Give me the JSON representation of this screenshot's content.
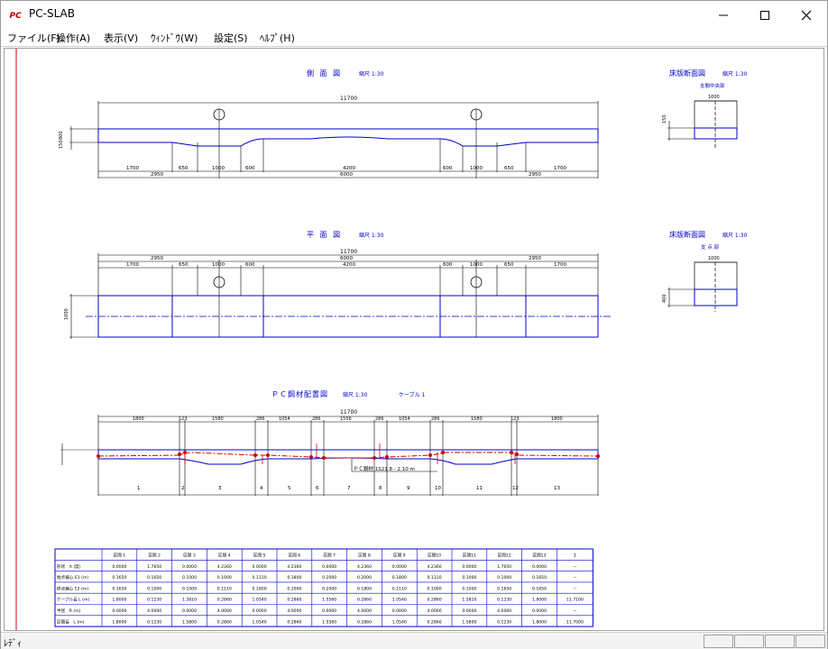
{
  "window": {
    "title": "PC-SLAB"
  },
  "menu": {
    "items": [
      "ファイル(F)",
      "操作(A)",
      "表示(V)",
      "ｳｨﾝﾄﾞｳ(W)",
      "設定(S)",
      "ﾍﾙﾌﾟ(H)"
    ]
  },
  "status": {
    "text": "ﾚﾃﾞｨ"
  },
  "side_view": {
    "title": "側 面 図",
    "scale": "縮尺 1:30",
    "total": "11700",
    "dims_bottom": [
      "1700",
      "650",
      "1000",
      "600",
      "4200",
      "600",
      "1000",
      "650",
      "1700"
    ],
    "dims_bottom2": [
      "2950",
      "6000",
      "2950"
    ],
    "left_dims": [
      "800",
      "150"
    ]
  },
  "plan_view": {
    "title": "平 面 図",
    "scale": "縮尺 1:30",
    "total": "11700",
    "dims_top1": [
      "2950",
      "6000",
      "2950"
    ],
    "dims_top2": [
      "1700",
      "650",
      "1000",
      "600",
      "4200",
      "600",
      "1000",
      "650",
      "1700"
    ],
    "width": "1000"
  },
  "section1": {
    "title": "床版断面図",
    "scale": "縮尺 1:30",
    "subtitle": "支間中央部",
    "width": "1000",
    "thickness": "150"
  },
  "section2": {
    "title": "床版断面図",
    "scale": "縮尺 1:30",
    "subtitle": "支 点 部",
    "width": "1000",
    "thickness": "400"
  },
  "pc_view": {
    "title": "ＰＣ鋼材配置図",
    "scale": "縮尺 1:30",
    "cable": "ケーブル 1",
    "total": "11700",
    "dims_top": [
      "1800",
      "123",
      "1580",
      "286",
      "1054",
      "286",
      "1556",
      "286",
      "1054",
      "286",
      "1580",
      "123",
      "1800"
    ],
    "segments": [
      "1",
      "2",
      "3",
      "4",
      "5",
      "6",
      "7",
      "8",
      "9",
      "10",
      "11",
      "12",
      "13"
    ],
    "annotation": "ＰＣ鋼材 1S21.8 ‐ 2.10 m"
  },
  "table": {
    "headers": [
      "",
      "区間 1",
      "区間 2",
      "区間 3",
      "区間 4",
      "区間 5",
      "区間 6",
      "区間 7",
      "区間 8",
      "区間 9",
      "区間10",
      "区間11",
      "区間12",
      "区間13",
      "Σ"
    ],
    "rows": [
      [
        "形状　A (度)",
        "0.0000",
        "1.7650",
        "0.0000",
        "4.2360",
        "0.0000",
        "4.2360",
        "0.0000",
        "4.2360",
        "0.0000",
        "4.2360",
        "0.0000",
        "1.7650",
        "0.0000",
        "－"
      ],
      [
        "始点偏心 E1 (m)",
        "0.1650",
        "0.1650",
        "0.1000",
        "0.1000",
        "0.1110",
        "0.1800",
        "0.2000",
        "0.2000",
        "0.1800",
        "0.1110",
        "0.1000",
        "0.1000",
        "0.1650",
        "－"
      ],
      [
        "終点偏心 E2 (m)",
        "0.1650",
        "0.1000",
        "0.1000",
        "0.1110",
        "0.1800",
        "0.2000",
        "0.2000",
        "0.1800",
        "0.1110",
        "0.1000",
        "0.1000",
        "0.1650",
        "0.1650",
        "－"
      ],
      [
        "ケーブル長 L (m)",
        "1.8000",
        "0.1230",
        "1.5810",
        "0.2860",
        "1.0540",
        "0.2860",
        "1.5560",
        "0.2860",
        "1.0540",
        "0.2860",
        "1.5810",
        "0.1230",
        "1.8000",
        "11.7100"
      ],
      [
        "半径　R (m)",
        "0.0000",
        "4.0000",
        "0.0000",
        "4.0000",
        "0.0000",
        "4.0000",
        "0.0000",
        "4.0000",
        "0.0000",
        "4.0000",
        "0.0000",
        "4.0000",
        "0.0000",
        "－"
      ],
      [
        "区間長　L (m)",
        "1.8000",
        "0.1230",
        "1.5800",
        "0.2860",
        "1.0540",
        "0.2860",
        "1.5560",
        "0.2860",
        "1.0540",
        "0.2860",
        "1.5800",
        "0.1230",
        "1.8000",
        "11.7000"
      ]
    ]
  },
  "colors": {
    "drawing": "#0000cc",
    "cable": "#cc0000",
    "dim": "#000000"
  }
}
